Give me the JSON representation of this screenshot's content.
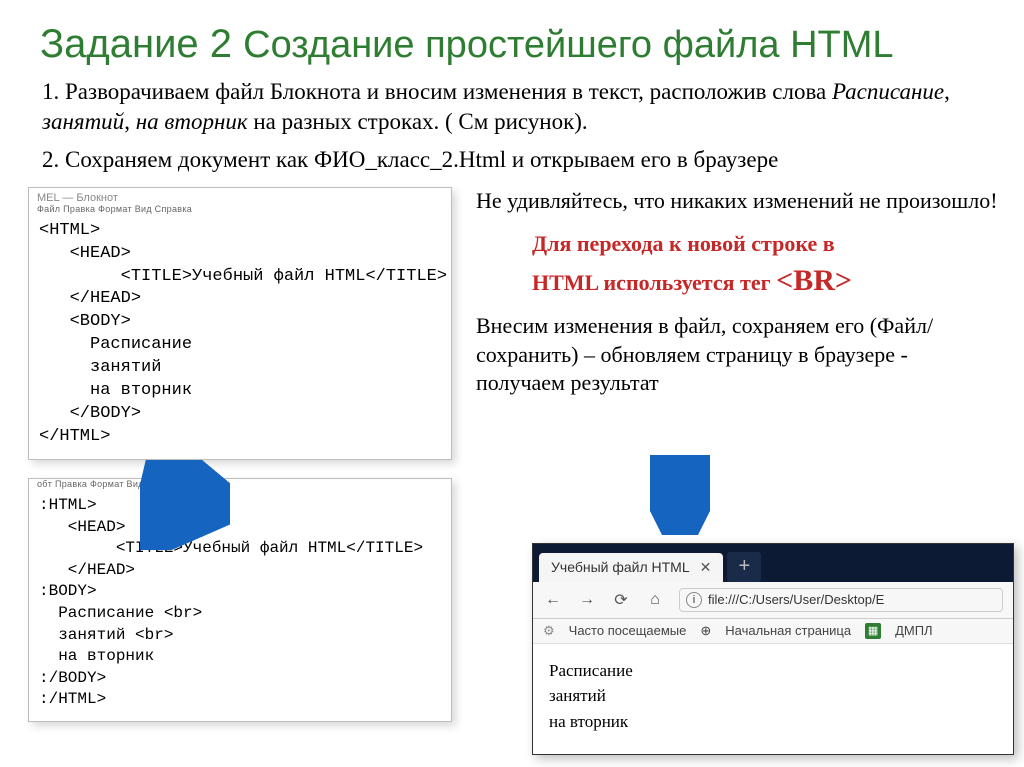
{
  "title_big": "Задание 2 ",
  "title_small": "Создание простейшего файла HTML",
  "instr1_a": "1. Разворачиваем файл Блокнота и вносим изменения в текст, расположив слова ",
  "instr1_b": "Расписание",
  "instr1_c": ", ",
  "instr1_d": "занятий",
  "instr1_e": ", ",
  "instr1_f": "на вторник",
  "instr1_g": " на разных строках. ( См рисунок).",
  "instr2": "2. Сохраняем документ как ФИО_класс_2.Html и открываем его в браузере",
  "notepad1": {
    "title": "MEL — Блокнот",
    "menu": "Файл  Правка  Формат  Вид  Справка",
    "code": "<HTML>\n   <HEAD>\n        <TITLE>Учебный файл HTML</TITLE>\n   </HEAD>\n   <BODY>\n     Расписание\n     занятий\n     на вторник\n   </BODY>\n</HTML>"
  },
  "right_note1": "Не удивляйтесь, что никаких изменений не произошло!",
  "red1": "Для перехода к новой строке в",
  "red2a": "HTML используется тег ",
  "red2b": "<BR>",
  "right_note2": "Внесим изменения в файл, сохраняем его (Файл/сохранить) – обновляем страницу в браузере - получаем результат",
  "notepad2": {
    "menu": "обт  Правка  Формат  Вид  Справка",
    "code": ":HTML>\n   <HEAD>\n        <TITLE>Учебный файл HTML</TITLE>\n   </HEAD>\n:BODY>\n  Расписание <br>\n  занятий <br>\n  на вторник\n:/BODY>\n:/HTML>"
  },
  "browser": {
    "tab": "Учебный файл HTML",
    "url": "file:///C:/Users/User/Desktop/E",
    "bookmark1": "Часто посещаемые",
    "bookmark2": "Начальная страница",
    "bookmark3": "ДМПЛ",
    "line1": "Расписание",
    "line2": "занятий",
    "line3": "на вторник"
  }
}
